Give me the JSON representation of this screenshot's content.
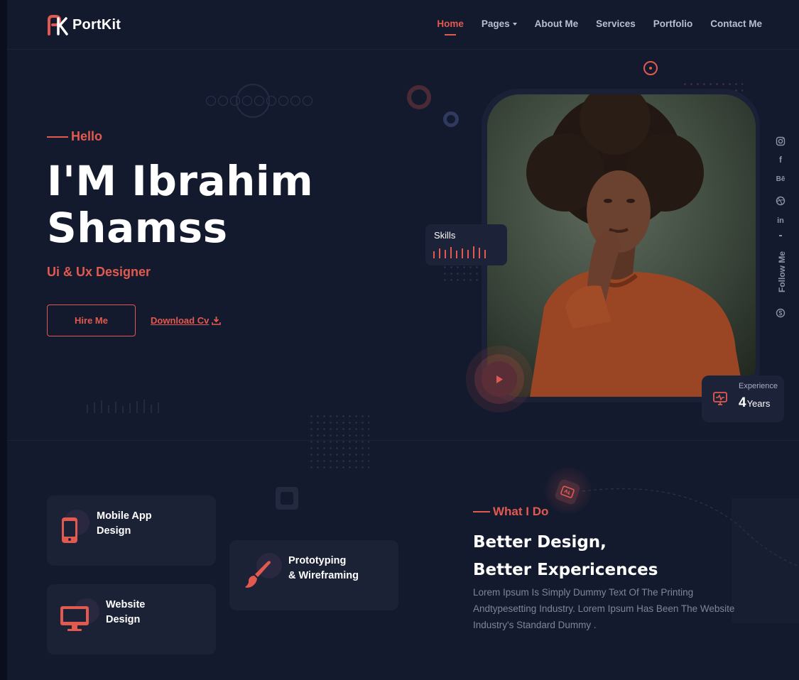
{
  "brand": {
    "name_part1": "Port",
    "name_part2": "Kit",
    "accent_color": "#e25a4f"
  },
  "nav": {
    "items": [
      {
        "label": "Home",
        "active": true
      },
      {
        "label": "Pages",
        "has_dropdown": true
      },
      {
        "label": "About Me"
      },
      {
        "label": "Services"
      },
      {
        "label": "Portfolio"
      },
      {
        "label": "Contact Me"
      }
    ]
  },
  "hero": {
    "greeting": "Hello",
    "name_line1": "I'M Ibrahim",
    "name_line2": "Shamss",
    "role": "Ui & Ux Designer",
    "hire_label": "Hire Me",
    "download_label": "Download Cv",
    "skills_label": "Skills",
    "experience_label": "Experience",
    "experience_value": "4",
    "experience_unit": "Years"
  },
  "social": {
    "follow_label": "Follow Me",
    "icons": [
      "instagram-icon",
      "facebook-icon",
      "behance-icon",
      "dribbble-icon",
      "linkedin-icon",
      "skype-icon"
    ],
    "labels": {
      "facebook": "f",
      "behance": "Bē",
      "linkedin": "in"
    }
  },
  "services": [
    {
      "title_line1": "Mobile App",
      "title_line2": "Design",
      "icon": "mobile-icon"
    },
    {
      "title_line1": "Prototyping",
      "title_line2": "& Wireframing",
      "icon": "brush-icon"
    },
    {
      "title_line1": "Website",
      "title_line2": "Design",
      "icon": "monitor-icon"
    }
  ],
  "what_i_do": {
    "eyebrow": "What I Do",
    "heading_line1": "Better Design,",
    "heading_line2": "Better Expericences",
    "description": "Lorem Ipsum Is Simply Dummy Text Of The Printing Andtypesetting Industry. Lorem Ipsum Has Been The Website Industry's Standard Dummy ."
  }
}
